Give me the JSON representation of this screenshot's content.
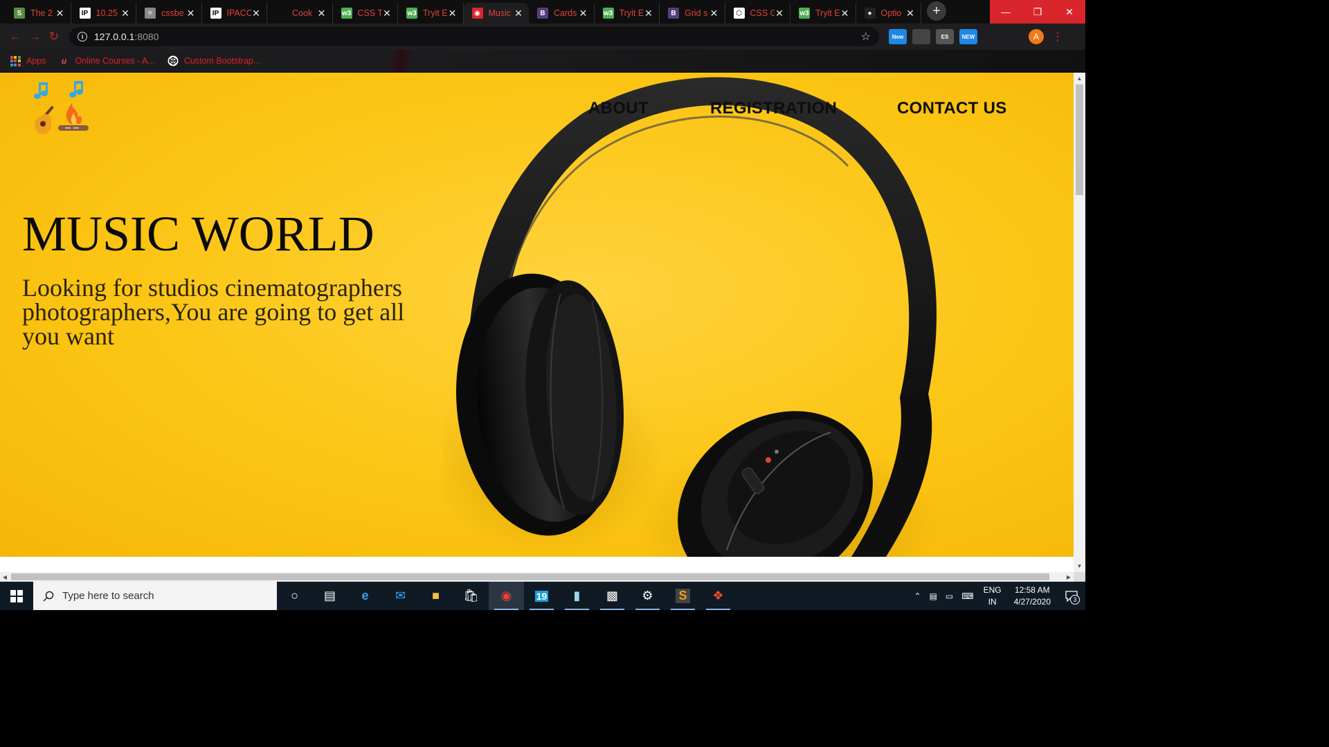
{
  "browser": {
    "tabs": [
      {
        "title": "The 2",
        "icon": "shopify-icon",
        "icon_color": "#5a8e3a"
      },
      {
        "title": "10.25",
        "icon": "ip-icon",
        "icon_color": "#ffffff"
      },
      {
        "title": "cssbe",
        "icon": "atom-icon",
        "icon_color": "#888888"
      },
      {
        "title": "IPACC",
        "icon": "ip-icon",
        "icon_color": "#ffffff"
      },
      {
        "title": "Cook",
        "icon": "blank-icon",
        "icon_color": "#0f0f10"
      },
      {
        "title": "CSS T",
        "icon": "w3schools-icon",
        "icon_color": "#4caf50"
      },
      {
        "title": "Tryit E",
        "icon": "w3schools-icon",
        "icon_color": "#4caf50"
      },
      {
        "title": "Music",
        "icon": "globe-icon",
        "icon_color": "#d9262c",
        "active": true
      },
      {
        "title": "Cards",
        "icon": "bootstrap-icon",
        "icon_color": "#563d7c"
      },
      {
        "title": "Tryit E",
        "icon": "w3schools-icon",
        "icon_color": "#4caf50"
      },
      {
        "title": "Grid s",
        "icon": "bootstrap-icon",
        "icon_color": "#563d7c"
      },
      {
        "title": "CSS G",
        "icon": "codepen-icon",
        "icon_color": "#ffffff"
      },
      {
        "title": "Tryit E",
        "icon": "w3schools-icon",
        "icon_color": "#4caf50"
      },
      {
        "title": "Optio",
        "icon": "github-icon",
        "icon_color": "#222222"
      }
    ],
    "url_host": "127.0.0.1",
    "url_port": ":8080",
    "extensions": [
      {
        "icon": "new-badge-ext-icon",
        "label": "New",
        "color": "#1e88e5"
      },
      {
        "icon": "record-ext-icon",
        "label": "",
        "color": "#444444"
      },
      {
        "icon": "es-ext-icon",
        "label": "ES",
        "color": "#555555"
      },
      {
        "icon": "new-red-ext-icon",
        "label": "NEW",
        "color": "#1e88e5"
      },
      {
        "icon": "pen-ext-icon",
        "label": "",
        "color": "#1e1e20"
      },
      {
        "icon": "ethereum-ext-icon",
        "label": "",
        "color": "#1e1e20"
      }
    ],
    "profile_initial": "A",
    "bookmarks": [
      {
        "label": "Apps",
        "icon": "apps-grid-icon"
      },
      {
        "label": "Online Courses - A...",
        "icon": "udemy-icon"
      },
      {
        "label": "Custom Bootstrap...",
        "icon": "codepen-icon"
      }
    ]
  },
  "page": {
    "nav": {
      "about": "ABOUT",
      "registration": "REGISTRATION",
      "contact": "CONTACT US"
    },
    "hero": {
      "title": "MUSIC WORLD",
      "subtitle": "Looking for studios cinematographers photographers,You are going to get all you want"
    },
    "colors": {
      "hero_bg": "#fcc514",
      "text": "#0b0b0b"
    }
  },
  "taskbar": {
    "search_placeholder": "Type here to search",
    "apps": [
      {
        "icon": "cortana-icon"
      },
      {
        "icon": "task-view-icon"
      },
      {
        "icon": "edge-icon"
      },
      {
        "icon": "mail-icon"
      },
      {
        "icon": "file-explorer-icon"
      },
      {
        "icon": "store-icon"
      },
      {
        "icon": "chrome-icon",
        "active": true
      },
      {
        "icon": "calendar-19-icon"
      },
      {
        "icon": "notepad-icon"
      },
      {
        "icon": "terminal-icon"
      },
      {
        "icon": "settings-icon"
      },
      {
        "icon": "sublime-icon"
      },
      {
        "icon": "figma-icon"
      }
    ],
    "lang_primary": "ENG",
    "lang_region": "IN",
    "time": "12:58 AM",
    "date": "4/27/2020",
    "notification_count": "3"
  }
}
